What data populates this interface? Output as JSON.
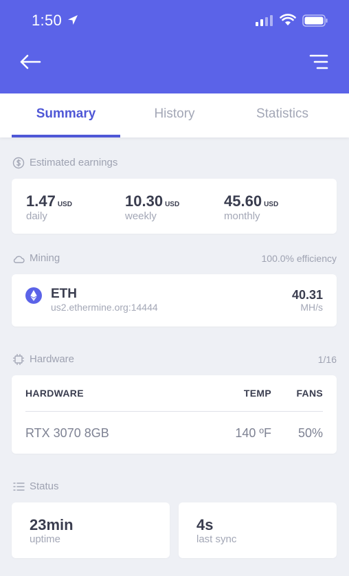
{
  "status_bar": {
    "time": "1:50"
  },
  "icons": {
    "location": "location-arrow-icon",
    "signal": "cellular-signal-icon",
    "wifi": "wifi-icon",
    "battery": "battery-icon",
    "back": "back-arrow-icon",
    "menu": "menu-icon"
  },
  "colors": {
    "header": "#5b63e8",
    "accent": "#4f57d6",
    "background": "#eef0f5"
  },
  "tabs": [
    {
      "label": "Summary",
      "active": true
    },
    {
      "label": "History",
      "active": false
    },
    {
      "label": "Statistics",
      "active": false
    }
  ],
  "earnings": {
    "section_label": "Estimated earnings",
    "items": [
      {
        "value": "1.47",
        "unit": "USD",
        "period": "daily"
      },
      {
        "value": "10.30",
        "unit": "USD",
        "period": "weekly"
      },
      {
        "value": "45.60",
        "unit": "USD",
        "period": "monthly"
      }
    ]
  },
  "mining": {
    "section_label": "Mining",
    "efficiency": "100.0% efficiency",
    "coin": "ETH",
    "pool": "us2.ethermine.org:14444",
    "hashrate": "40.31",
    "hashrate_unit": "MH/s"
  },
  "hardware": {
    "section_label": "Hardware",
    "count": "1/16",
    "headers": {
      "hardware": "HARDWARE",
      "temp": "TEMP",
      "fans": "FANS"
    },
    "rows": [
      {
        "name": "RTX 3070 8GB",
        "temp": "140 ºF",
        "fans": "50%"
      }
    ]
  },
  "status": {
    "section_label": "Status",
    "uptime_value": "23min",
    "uptime_label": "uptime",
    "sync_value": "4s",
    "sync_label": "last sync"
  }
}
